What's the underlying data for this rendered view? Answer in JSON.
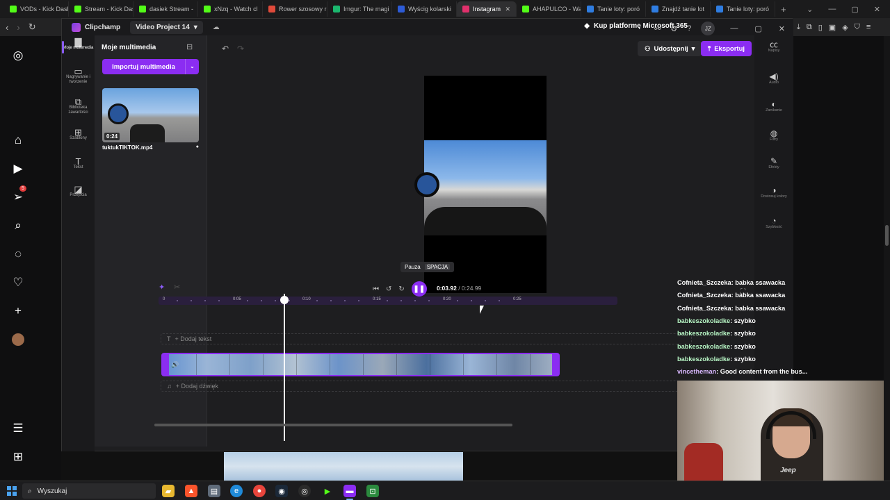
{
  "browser": {
    "tabs": [
      {
        "label": "VODs - Kick Dash",
        "icon": "kick-favicon",
        "color": "#53fc18"
      },
      {
        "label": "Stream - Kick Das",
        "icon": "kick-favicon",
        "color": "#53fc18"
      },
      {
        "label": "dasiek Stream - ",
        "icon": "kick-favicon",
        "color": "#53fc18"
      },
      {
        "label": "xNzq - Watch cl",
        "icon": "kick-favicon",
        "color": "#53fc18"
      },
      {
        "label": "Rower szosowy r",
        "icon": "shop-favicon",
        "color": "#e04a3a"
      },
      {
        "label": "Imgur: The magi",
        "icon": "imgur-favicon",
        "color": "#1bb76e"
      },
      {
        "label": "Wyścig kolarski ",
        "icon": "news-favicon",
        "color": "#2d5bd6"
      },
      {
        "label": "Instagram",
        "icon": "instagram-favicon",
        "color": "#e1306c",
        "active": true
      },
      {
        "label": "AHAPULCO - Wa",
        "icon": "kick-favicon",
        "color": "#53fc18"
      },
      {
        "label": "Tanie loty: poró",
        "icon": "flights-favicon",
        "color": "#2f7de1"
      },
      {
        "label": "Znajdź tanie lot",
        "icon": "flights-favicon",
        "color": "#2f7de1"
      },
      {
        "label": "Tanie loty: poró",
        "icon": "flights-favicon",
        "color": "#2f7de1"
      }
    ],
    "new_tab": "+",
    "sidebar_badge": "5"
  },
  "app": {
    "name": "Clipchamp",
    "project": "Video Project 14",
    "ms_offer": "Kup platformę Microsoft 365",
    "avatar": "JZ",
    "rail": [
      {
        "label": "Moje multimedia",
        "icon": "folder-icon"
      },
      {
        "label": "Nagrywanie i tworzenie",
        "icon": "camera-icon"
      },
      {
        "label": "Biblioteka zawartości",
        "icon": "library-icon"
      },
      {
        "label": "Szablony",
        "icon": "templates-icon"
      },
      {
        "label": "Tekst",
        "icon": "text-icon"
      },
      {
        "label": "Przejścia",
        "icon": "transitions-icon"
      }
    ],
    "media": {
      "title": "Moje multimedia",
      "import_label": "Importuj multimedia",
      "thumb_duration": "0:24",
      "thumb_name": "tuktukTIKTOK.mp4"
    },
    "share_label": "Udostępnij",
    "export_label": "Eksportuj",
    "props": [
      {
        "label": "Napisy",
        "icon": "captions-icon"
      },
      {
        "label": "Audio",
        "icon": "audio-icon"
      },
      {
        "label": "Zanikanie",
        "icon": "fade-icon"
      },
      {
        "label": "Filtry",
        "icon": "filters-icon"
      },
      {
        "label": "Efekty",
        "icon": "effects-icon"
      },
      {
        "label": "Dostosuj kolory",
        "icon": "color-icon"
      },
      {
        "label": "Szybkość",
        "icon": "speed-icon"
      }
    ],
    "tooltip": {
      "label": "Pauza",
      "key": "SPACJA"
    },
    "time_current": "0:03.92",
    "time_total": " / 0:24.99",
    "ruler_ticks": [
      "0",
      "0:05",
      "0:10",
      "0:15",
      "0:20",
      "0:25"
    ],
    "add_text": "+ Dodaj tekst",
    "add_audio": "+ Dodaj dźwięk",
    "playhead_fraction": 0.157
  },
  "chat": [
    {
      "user": "Cofnieta_Szczeka",
      "msg": "babka ssawacka",
      "color": "#ffffff"
    },
    {
      "user": "Cofnieta_Szczeka",
      "msg": "babka ssawacka",
      "color": "#ffffff"
    },
    {
      "user": "Cofnieta_Szczeka",
      "msg": "babka ssawacka",
      "color": "#ffffff"
    },
    {
      "user": "babkeszokoladke",
      "msg": "szybko",
      "color": "#b7f5c4"
    },
    {
      "user": "babkeszokoladke",
      "msg": "szybko",
      "color": "#b7f5c4"
    },
    {
      "user": "babkeszokoladke",
      "msg": "szybko",
      "color": "#b7f5c4"
    },
    {
      "user": "babkeszokoladke",
      "msg": "szybko",
      "color": "#b7f5c4"
    },
    {
      "user": "vincetheman",
      "msg": "Good content from the bus...",
      "color": "#d9b8ff"
    }
  ],
  "webcam": {
    "shirt_text": "Jeep"
  },
  "taskbar": {
    "search_label": "Wyszukaj"
  }
}
